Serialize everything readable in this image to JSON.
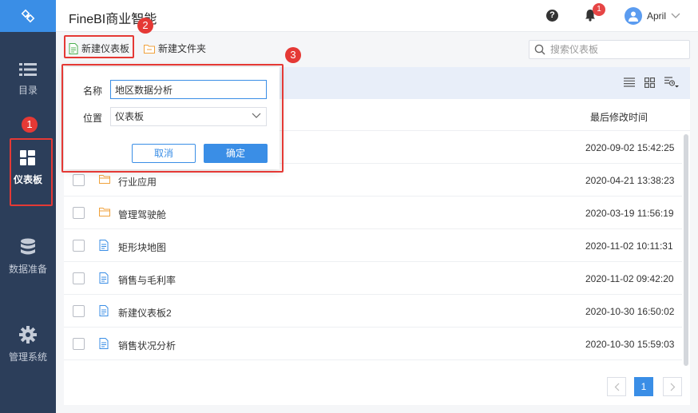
{
  "app": {
    "title": "FineBI商业智能"
  },
  "header": {
    "notification_count": "1",
    "user_name": "April"
  },
  "sidebar": {
    "items": [
      {
        "label": "目录",
        "icon": "list-icon"
      },
      {
        "label": "仪表板",
        "icon": "dashboard-icon"
      },
      {
        "label": "数据准备",
        "icon": "database-icon"
      },
      {
        "label": "管理系统",
        "icon": "gear-icon"
      }
    ]
  },
  "toolbar": {
    "new_dashboard": "新建仪表板",
    "new_folder": "新建文件夹",
    "search_placeholder": "搜索仪表板"
  },
  "table": {
    "time_header": "最后修改时间",
    "rows": [
      {
        "name": "",
        "time": "2020-09-02 15:42:25",
        "type": "folder"
      },
      {
        "name": "行业应用",
        "time": "2020-04-21 13:38:23",
        "type": "folder"
      },
      {
        "name": "管理驾驶舱",
        "time": "2020-03-19 11:56:19",
        "type": "folder"
      },
      {
        "name": "矩形块地图",
        "time": "2020-11-02 10:11:31",
        "type": "file"
      },
      {
        "name": "销售与毛利率",
        "time": "2020-11-02 09:42:20",
        "type": "file"
      },
      {
        "name": "新建仪表板2",
        "time": "2020-10-30 16:50:02",
        "type": "file"
      },
      {
        "name": "销售状况分析",
        "time": "2020-10-30 15:59:03",
        "type": "file"
      }
    ]
  },
  "pagination": {
    "current": "1"
  },
  "dialog": {
    "name_label": "名称",
    "name_value": "地区数据分析",
    "location_label": "位置",
    "location_value": "仪表板",
    "cancel": "取消",
    "ok": "确定"
  },
  "annotations": {
    "n1": "1",
    "n2": "2",
    "n3": "3"
  },
  "colors": {
    "accent": "#3a8ee6",
    "sidebar": "#2c3e5a",
    "annotation": "#e53935",
    "folder": "#f0a23c"
  }
}
